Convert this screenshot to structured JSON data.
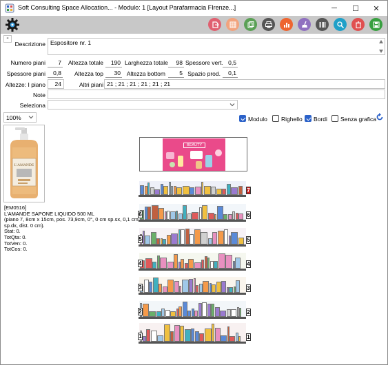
{
  "window": {
    "title": "Soft Consulting Space Allocation... - Modulo: 1 [Layout Parafarmacia FIrenze...]",
    "minimize_glyph": "─",
    "maximize_glyph": "☐",
    "close_glyph": "✕"
  },
  "toolbar": {
    "buttons": [
      {
        "name": "export-icon",
        "color": "#e06070"
      },
      {
        "name": "grid-icon",
        "color": "#f2a37e"
      },
      {
        "name": "copy-icon",
        "color": "#5aa055"
      },
      {
        "name": "print-icon",
        "color": "#555555"
      },
      {
        "name": "chart-icon",
        "color": "#ee6530"
      },
      {
        "name": "broom-icon",
        "color": "#9070c0"
      },
      {
        "name": "barcode-icon",
        "color": "#555555"
      },
      {
        "name": "search-icon",
        "color": "#1fa0c8"
      },
      {
        "name": "delete-icon",
        "color": "#e05050"
      },
      {
        "name": "save-icon",
        "color": "#38a040"
      }
    ]
  },
  "form": {
    "collapse_glyph": "-",
    "descrizione_label": "Descrizione",
    "descrizione_value": "Espositore nr. 1",
    "numero_piani_label": "Numero piani",
    "numero_piani_value": "7",
    "altezza_totale_label": "Altezza totale",
    "altezza_totale_value": "190",
    "larghezza_totale_label": "Larghezza totale",
    "larghezza_totale_value": "98",
    "spessore_vert_label": "Spessore vert.",
    "spessore_vert_value": "0,5",
    "spessore_piani_label": "Spessore piani",
    "spessore_piani_value": "0,8",
    "altezza_top_label": "Altezza top",
    "altezza_top_value": "30",
    "altezza_bottom_label": "Altezza bottom",
    "altezza_bottom_value": "5",
    "spazio_prod_label": "Spazio prod.",
    "spazio_prod_value": "0,1",
    "altezze_label": "Altezze: I piano",
    "altezze_value": "24",
    "altri_piani_label": "Altri piani",
    "altri_piani_value": "21 ; 21 ; 21 ; 21 ; 21 ; 21",
    "note_label": "Note",
    "note_value": "",
    "seleziona_label": "Seleziona",
    "seleziona_value": ""
  },
  "view": {
    "zoom": "100%",
    "modulo_label": "Modulo",
    "modulo_checked": true,
    "righello_label": "Righello",
    "righello_checked": false,
    "bordi_label": "Bordi",
    "bordi_checked": true,
    "senza_grafica_label": "Senza grafica",
    "senza_grafica_checked": false
  },
  "product": {
    "code": "[EM0516]",
    "name": "L'AMANDE SAPONE LIQUIDO 500 ML",
    "details": "(piano 7, 8cm x 15cm, pos. 73,9cm, 0°, 0 cm sp.sx, 0,1 cm sp.dx, dist. 0 cm).",
    "stat": "Stat: 0.",
    "totqta": "TotQta: 0.",
    "totven": "TotVen: 0.",
    "totcos": "TotCos: 0.",
    "image_brand": "L'AMANDE"
  },
  "shelf": {
    "header_text": "BEAUTY",
    "shelf_numbers": [
      "7",
      "6",
      "5",
      "4",
      "3",
      "2",
      "1"
    ],
    "shelf_colors": [
      "#cfd3ea",
      "#dbe6f2",
      "#e9d9e6",
      "#e3e9d2",
      "#f2e2cb",
      "#d9e6ef",
      "#ecd7d7"
    ]
  }
}
